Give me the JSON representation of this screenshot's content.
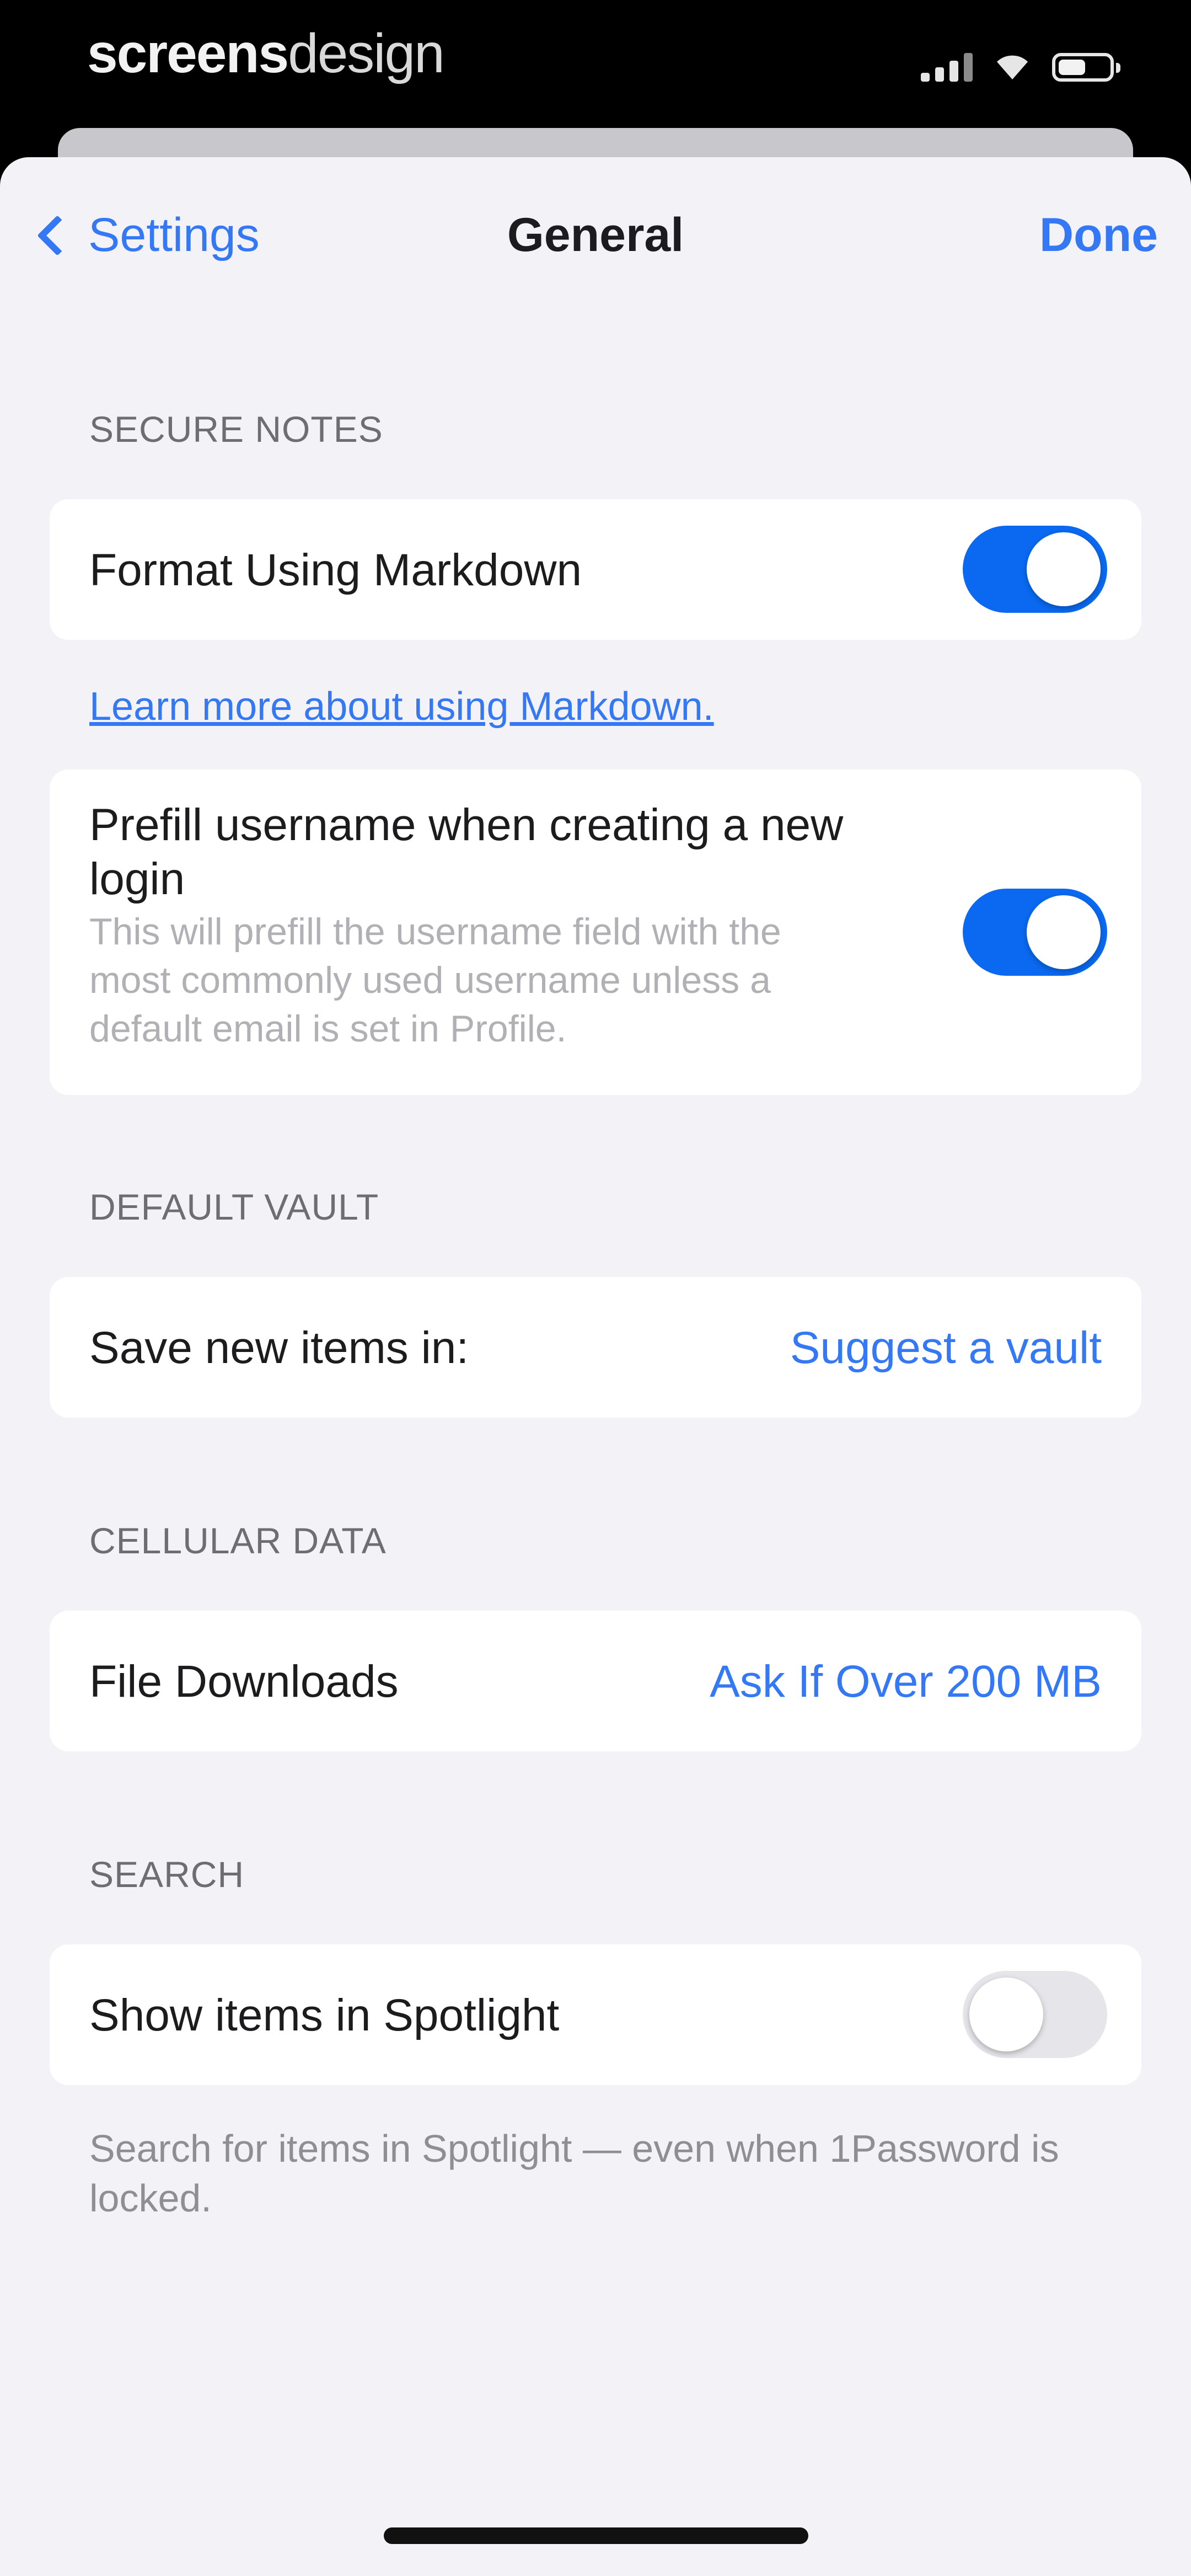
{
  "status_bar": {
    "brand_bold": "screens",
    "brand_light": "design"
  },
  "nav": {
    "back_label": "Settings",
    "title": "General",
    "done_label": "Done"
  },
  "secure_notes": {
    "header": "SECURE NOTES",
    "markdown_label": "Format Using Markdown",
    "markdown_enabled": true,
    "learn_more_link": "Learn more about using Markdown.",
    "prefill_label": "Prefill username when creating a new login",
    "prefill_description": "This will prefill the username field with the most commonly used username unless a default email is set in Profile.",
    "prefill_enabled": true
  },
  "default_vault": {
    "header": "DEFAULT VAULT",
    "label": "Save new items in:",
    "value": "Suggest a vault"
  },
  "cellular_data": {
    "header": "CELLULAR DATA",
    "label": "File Downloads",
    "value": "Ask If Over 200 MB"
  },
  "search": {
    "header": "SEARCH",
    "spotlight_label": "Show items in Spotlight",
    "spotlight_enabled": false,
    "footer": "Search for items in Spotlight — even when 1Password is locked."
  },
  "colors": {
    "accent": "#3478f6",
    "toggle_on": "#0a69f0",
    "background": "#f2f2f7"
  }
}
